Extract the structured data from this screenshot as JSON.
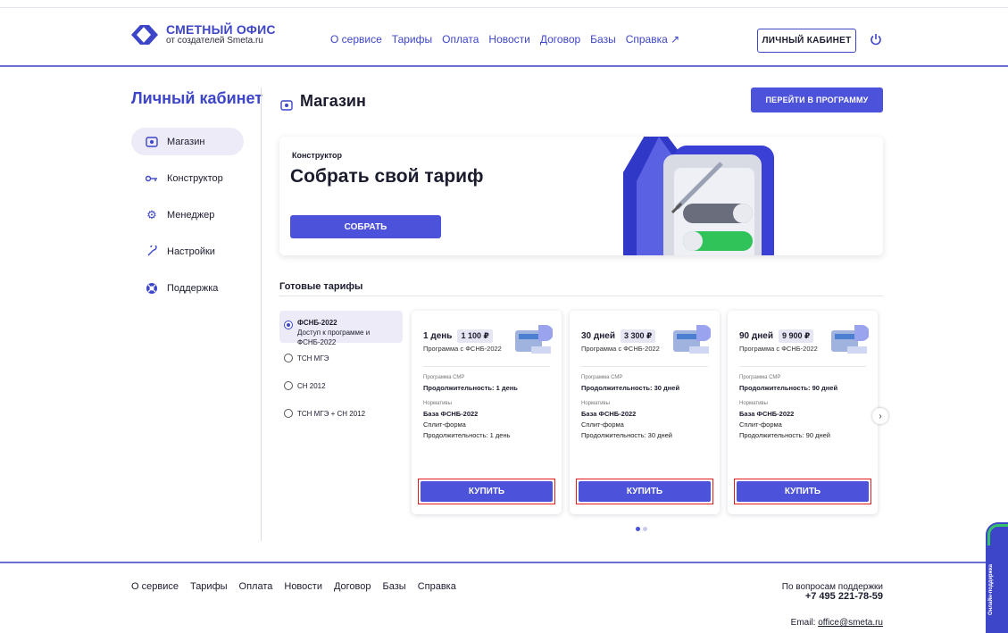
{
  "header": {
    "logo_title": "СМЕТНЫЙ ОФИС",
    "logo_subtitle": "от создателей Smeta.ru",
    "nav": [
      "О сервисе",
      "Тарифы",
      "Оплата",
      "Новости",
      "Договор",
      "Базы",
      "Справка ↗"
    ],
    "cabinet_button": "ЛИЧНЫЙ КАБИНЕТ"
  },
  "sidebar": {
    "title": "Личный кабинет",
    "items": [
      {
        "label": "Магазин",
        "icon": "shop-icon",
        "active": true
      },
      {
        "label": "Конструктор",
        "icon": "key-icon"
      },
      {
        "label": "Менеджер",
        "icon": "gear-icon"
      },
      {
        "label": "Настройки",
        "icon": "wrench-icon"
      },
      {
        "label": "Поддержка",
        "icon": "lifebuoy-icon"
      }
    ]
  },
  "main": {
    "title": "Магазин",
    "go_button": "ПЕРЕЙТИ В ПРОГРАММУ",
    "banner": {
      "label": "Конструктор",
      "title": "Собрать свой тариф",
      "button": "СОБРАТЬ"
    },
    "section_title": "Готовые тарифы",
    "options": [
      {
        "label": "ФСНБ-2022",
        "sub": "Доступ к программе и ФСНБ-2022",
        "selected": true
      },
      {
        "label": "ТСН МГЭ"
      },
      {
        "label": "СН 2012"
      },
      {
        "label": "ТСН МГЭ + СН 2012"
      }
    ],
    "cards": [
      {
        "period": "1 день",
        "price": "1 100 ₽",
        "sub": "Программа с ФСНБ-2022",
        "prog_label": "Программа СМР",
        "duration": "Продолжительность: 1 день",
        "norm_label": "Нормативы",
        "base": "База ФСНБ-2022",
        "form": "Сплит-форма",
        "duration2": "Продолжительность: 1 день",
        "buy": "КУПИТЬ"
      },
      {
        "period": "30 дней",
        "price": "3 300 ₽",
        "sub": "Программа с ФСНБ-2022",
        "prog_label": "Программа СМР",
        "duration": "Продолжительность: 30 дней",
        "norm_label": "Нормативы",
        "base": "База ФСНБ-2022",
        "form": "Сплит-форма",
        "duration2": "Продолжительность: 30 дней",
        "buy": "КУПИТЬ"
      },
      {
        "period": "90 дней",
        "price": "9 900 ₽",
        "sub": "Программа с ФСНБ-2022",
        "prog_label": "Программа СМР",
        "duration": "Продолжительность: 90 дней",
        "norm_label": "Нормативы",
        "base": "База ФСНБ-2022",
        "form": "Сплит-форма",
        "duration2": "Продолжительность: 90 дней",
        "buy": "КУПИТЬ"
      }
    ]
  },
  "footer": {
    "nav": [
      "О сервисе",
      "Тарифы",
      "Оплата",
      "Новости",
      "Договор",
      "Базы",
      "Справка"
    ],
    "support_label": "По вопросам поддержки",
    "phone": "+7 495 221-78-59",
    "email_label": "Email: ",
    "email": "office@smeta.ru"
  },
  "online_support": "Онлайн-поддержка",
  "colors": {
    "accent": "#4c52d9",
    "brand": "#3d45c8",
    "highlight": "#e21b1b"
  }
}
